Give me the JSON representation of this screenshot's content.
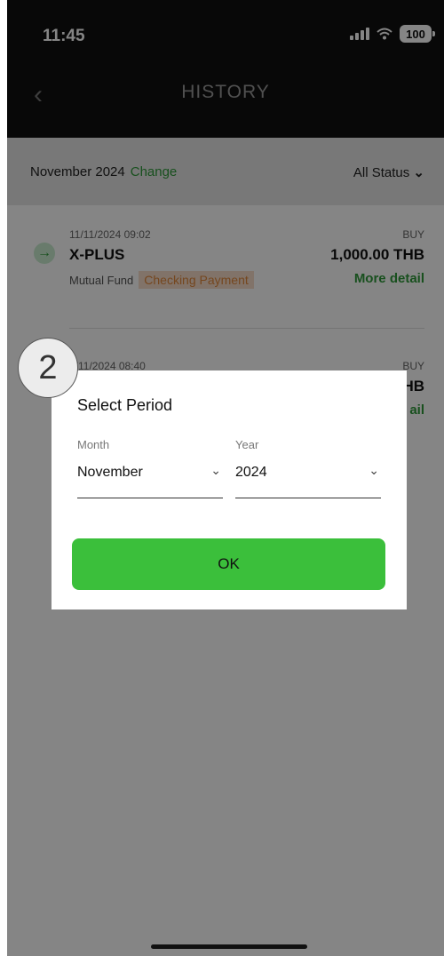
{
  "status_bar": {
    "time": "11:45",
    "battery": "100"
  },
  "header": {
    "back_icon": "‹",
    "title": "HISTORY"
  },
  "filter": {
    "period": "November 2024",
    "change_link": "Change",
    "status": "All Status",
    "status_chevron": "⌄"
  },
  "transactions": [
    {
      "datetime": "11/11/2024 09:02",
      "type": "BUY",
      "name": "X-PLUS",
      "amount": "1,000.00 THB",
      "category": "Mutual Fund",
      "status": "Checking Payment",
      "more": "More detail"
    },
    {
      "datetime": "7/11/2024 08:40",
      "type": "BUY",
      "amount_partial": "HB",
      "more_partial": "ail"
    }
  ],
  "step_marker": "2",
  "modal": {
    "title": "Select Period",
    "month_label": "Month",
    "month_value": "November",
    "year_label": "Year",
    "year_value": "2024",
    "ok_label": "OK"
  },
  "colors": {
    "accent_green": "#3bbf3b",
    "link_green": "#2f9a3a",
    "badge_orange": "#e0883c"
  }
}
